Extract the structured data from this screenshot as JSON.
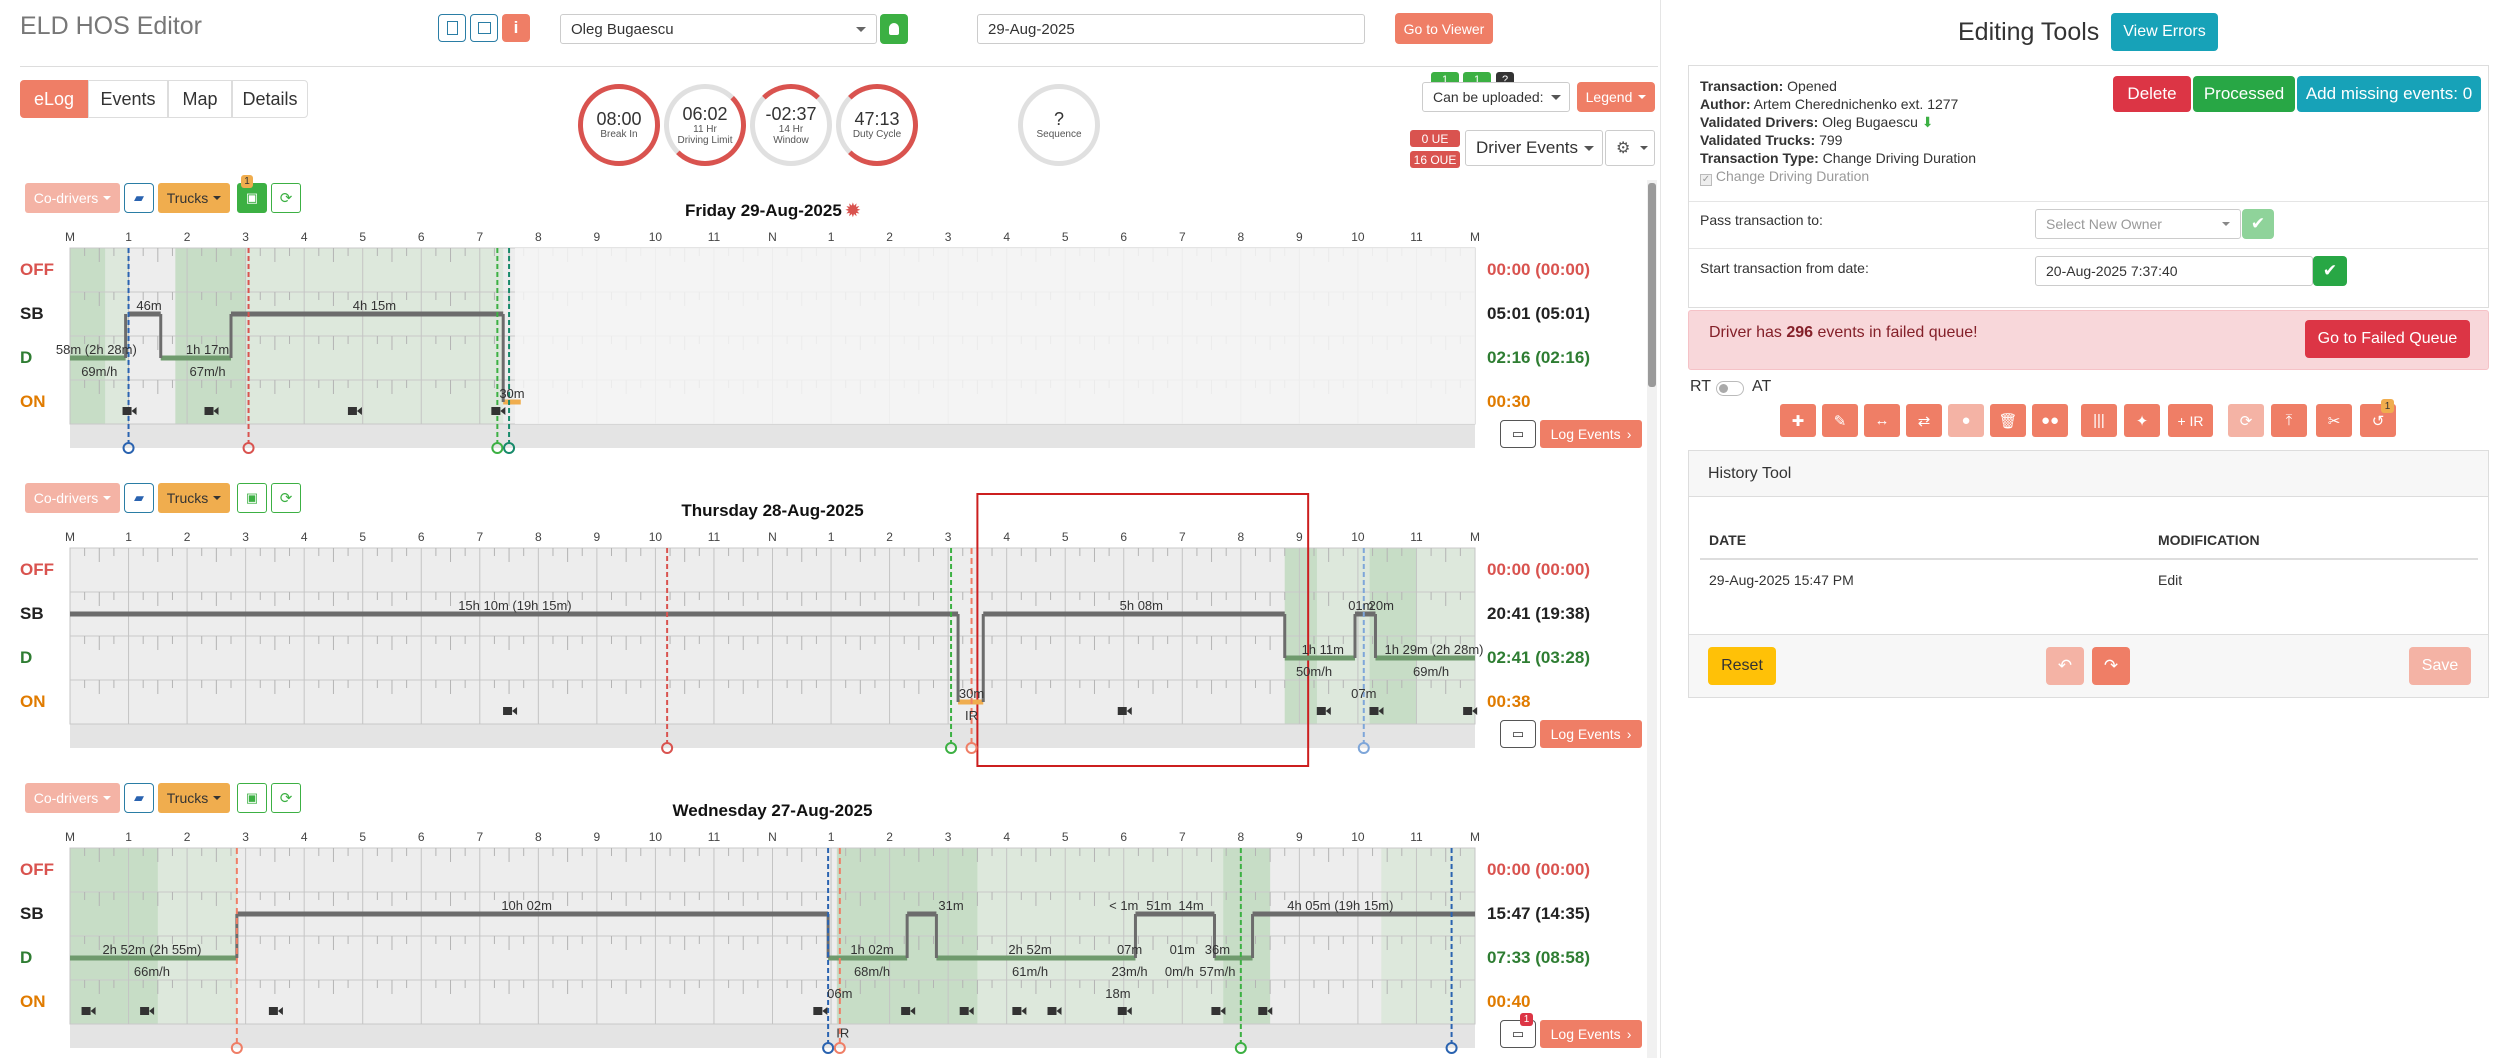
{
  "app_title": "ELD HOS Editor",
  "header": {
    "driver_select": "Oleg Bugaescu",
    "date_input": "29-Aug-2025",
    "go_to_viewer": "Go to Viewer"
  },
  "tabs": [
    "eLog",
    "Events",
    "Map",
    "Details"
  ],
  "gauges": [
    {
      "value": "08:00",
      "label": "Break In",
      "color": "#d9534f",
      "level": 1.0
    },
    {
      "value": "06:02",
      "label": "11 Hr\nDriving Limit",
      "color": "#d9534f",
      "level": 0.55
    },
    {
      "value": "-02:37",
      "label": "14 Hr\nWindow",
      "color": "#d9534f",
      "level": 0.15
    },
    {
      "value": "47:13",
      "label": "Duty Cycle",
      "color": "#d9534f",
      "level": 0.85
    },
    {
      "value": "?",
      "label": "Sequence",
      "color": "#bbbbbb",
      "level": 0
    }
  ],
  "upload": {
    "badges": [
      "1",
      "1",
      "?"
    ],
    "select": "Can be uploaded:",
    "legend": "Legend",
    "ue": "0 UE",
    "oue": "16 OUE",
    "driver_events": "Driver Events"
  },
  "row_labels": [
    "OFF",
    "SB",
    "D",
    "ON"
  ],
  "row_colors": [
    "#d9534f",
    "#222222",
    "#2e7d32",
    "#e07b00"
  ],
  "hour_labels": [
    "M",
    "1",
    "2",
    "3",
    "4",
    "5",
    "6",
    "7",
    "8",
    "9",
    "10",
    "11",
    "N",
    "1",
    "2",
    "3",
    "4",
    "5",
    "6",
    "7",
    "8",
    "9",
    "10",
    "11",
    "M"
  ],
  "days": [
    {
      "title": "Friday 29-Aug-2025",
      "codrivers": "Co-drivers",
      "trucks": "Trucks",
      "truck_badge": "1",
      "totals": [
        "00:00 (00:00)",
        "05:01 (05:01)",
        "02:16 (02:16)",
        "00:30"
      ],
      "segment_labels": [
        "46m",
        "4h 15m",
        "58m (2h 28m)",
        "1h 17m",
        "69m/h",
        "67m/h",
        "30m"
      ],
      "log_events": "Log Events"
    },
    {
      "title": "Thursday 28-Aug-2025",
      "codrivers": "Co-drivers",
      "trucks": "Trucks",
      "totals": [
        "00:00 (00:00)",
        "20:41 (19:38)",
        "02:41 (03:28)",
        "00:38"
      ],
      "segment_labels": [
        "15h 10m (19h 15m)",
        "5h 08m",
        "01m",
        "20m",
        "1h 11m",
        "1h 29m (2h 28m)",
        "50m/h",
        "69m/h",
        "30m",
        "07m",
        "IR"
      ],
      "log_events": "Log Events"
    },
    {
      "title": "Wednesday 27-Aug-2025",
      "codrivers": "Co-drivers",
      "trucks": "Trucks",
      "totals": [
        "00:00 (00:00)",
        "15:47 (14:35)",
        "07:33 (08:58)",
        "00:40"
      ],
      "segment_labels": [
        "10h 02m",
        "31m",
        "< 1m",
        "51m",
        "14m",
        "4h 05m (19h 15m)",
        "2h 52m (2h 55m)",
        "1h 02m",
        "2h 52m",
        "07m",
        "01m",
        "36m",
        "66m/h",
        "68m/h",
        "61m/h",
        "23m/h",
        "0m/h",
        "57m/h",
        "06m",
        "18m",
        "IR"
      ],
      "log_events": "Log Events",
      "comment_badge": "1"
    }
  ],
  "editing": {
    "title": "Editing Tools",
    "view_errors": "View Errors",
    "transaction_label": "Transaction:",
    "transaction": "Opened",
    "author_label": "Author:",
    "author": "Artem Cherednichenko ext. 1277",
    "validated_drivers_label": "Validated Drivers:",
    "validated_drivers": "Oleg Bugaescu",
    "validated_trucks_label": "Validated Trucks:",
    "validated_trucks": "799",
    "transaction_type_label": "Transaction Type:",
    "transaction_type": "Change Driving Duration",
    "checkbox_label": "Change Driving Duration",
    "delete": "Delete",
    "processed": "Processed",
    "add_missing": "Add missing events: 0",
    "pass_label": "Pass transaction to:",
    "pass_placeholder": "Select New Owner",
    "start_label": "Start transaction from date:",
    "start_value": "20-Aug-2025 7:37:40",
    "failed_pre": "Driver has ",
    "failed_count": "296",
    "failed_post": " events in failed queue!",
    "go_failed": "Go to Failed Queue",
    "rt": "RT",
    "at": "AT",
    "tool_badge": "1",
    "ir_label": "+ IR",
    "history_title": "History Tool",
    "col_date": "DATE",
    "col_mod": "MODIFICATION",
    "history_rows": [
      {
        "date": "29-Aug-2025 15:47 PM",
        "mod": "Edit"
      }
    ],
    "reset": "Reset",
    "save": "Save"
  },
  "colors": {
    "primary": "#ef7e66",
    "green": "#3cb043",
    "red": "#d9534f",
    "teal": "#17a2b8",
    "yellow": "#f0ad4e"
  }
}
